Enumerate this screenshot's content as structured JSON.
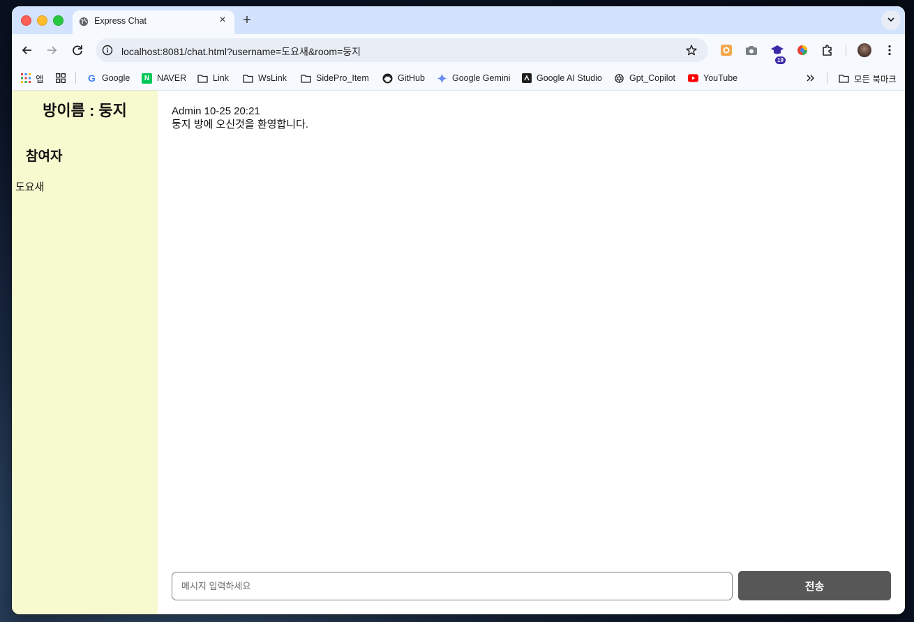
{
  "browser": {
    "tab_title": "Express Chat",
    "url": "localhost:8081/chat.html?username=도요새&room=둥지",
    "extension_badge": "19",
    "bookmarks": [
      {
        "label": "앱",
        "icon": "apps-grid-icon"
      },
      {
        "label": "",
        "icon": "tab-groups-icon"
      },
      {
        "label": "Google",
        "icon": "google-icon"
      },
      {
        "label": "NAVER",
        "icon": "naver-icon"
      },
      {
        "label": "Link",
        "icon": "folder-icon"
      },
      {
        "label": "WsLink",
        "icon": "folder-icon"
      },
      {
        "label": "SidePro_Item",
        "icon": "folder-icon"
      },
      {
        "label": "GitHub",
        "icon": "github-icon"
      },
      {
        "label": "Google Gemini",
        "icon": "gemini-icon"
      },
      {
        "label": "Google AI Studio",
        "icon": "ai-studio-icon"
      },
      {
        "label": "Gpt_Copilot",
        "icon": "openai-icon"
      },
      {
        "label": "YouTube",
        "icon": "youtube-icon"
      }
    ],
    "all_bookmarks": "모든 북마크"
  },
  "sidebar": {
    "room_title": "방이름 : 둥지",
    "users_heading": "참여자",
    "users": [
      "도요새"
    ]
  },
  "chat": {
    "messages": [
      {
        "meta": "Admin 10-25 20:21",
        "text": "둥지 방에 오신것을 환영합니다."
      }
    ],
    "input_placeholder": "메시지 입력하세요",
    "send_label": "전송"
  },
  "colors": {
    "sidebar_bg": "#f7f9cf",
    "send_button": "#575757",
    "browser_frame": "#d3e3fd"
  }
}
